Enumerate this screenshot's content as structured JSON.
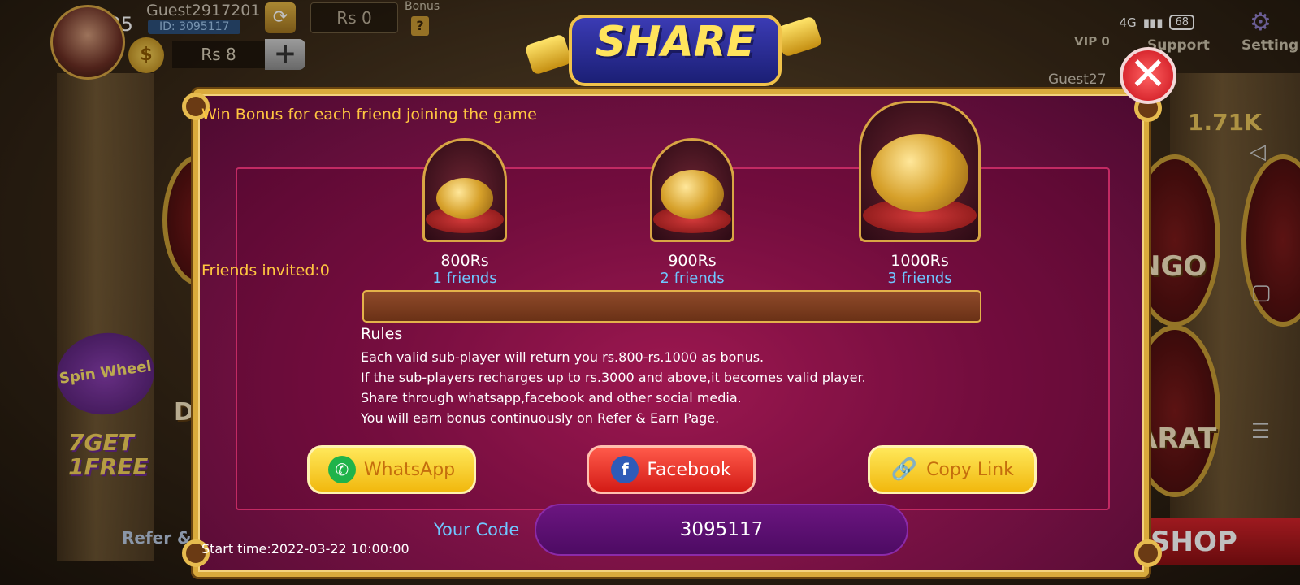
{
  "status_bar": {
    "time": "7:35",
    "network": "4G",
    "battery": "68"
  },
  "top_bar": {
    "guest_name": "Guest2917201",
    "guest_id": "ID: 3095117",
    "rs_value": "Rs  0",
    "bonus_label": "Bonus",
    "bonus_help": "?",
    "balance": "Rs  8",
    "plus": "+",
    "vip_label": "VIP 0",
    "support_label": "Support",
    "setting_label": "Setting",
    "right_user": "Guest27",
    "right_amount": "1.71K"
  },
  "lobby": {
    "spin_wheel_label": "Spin Wheel",
    "get_free_label": "7GET 1FREE",
    "refer_label": "Refer &",
    "shop_label": "SHOP",
    "bg_bingo": "NGO",
    "bg_baccarat": "ARAT",
    "bg_d": "D"
  },
  "dialog": {
    "title": "SHARE",
    "close_label": "✕",
    "headline": "Win Bonus for each friend joining the game",
    "friends_invited": "Friends invited:0",
    "tiers": [
      {
        "amount": "800Rs",
        "friends": "1 friends"
      },
      {
        "amount": "900Rs",
        "friends": "2 friends"
      },
      {
        "amount": "1000Rs",
        "friends": "3 friends"
      }
    ],
    "progress_fraction": 0,
    "rules_title": "Rules",
    "rules": [
      "Each valid sub-player will return you rs.800-rs.1000 as bonus.",
      "If the sub-players recharges up to rs.3000 and above,it becomes valid player.",
      "Share through whatsapp,facebook and other social media.",
      "You will earn bonus continuously on Refer & Earn Page."
    ],
    "buttons": {
      "whatsapp": "WhatsApp",
      "facebook": "Facebook",
      "copy_link": "Copy Link"
    },
    "your_code_label": "Your Code",
    "your_code": "3095117",
    "start_time": "Start time:2022-03-22 10:00:00"
  },
  "colors": {
    "panel": "#7d1246",
    "gold": "#d9aa3c",
    "headline": "#ffc640",
    "friends_blue": "#6fc6ff"
  }
}
